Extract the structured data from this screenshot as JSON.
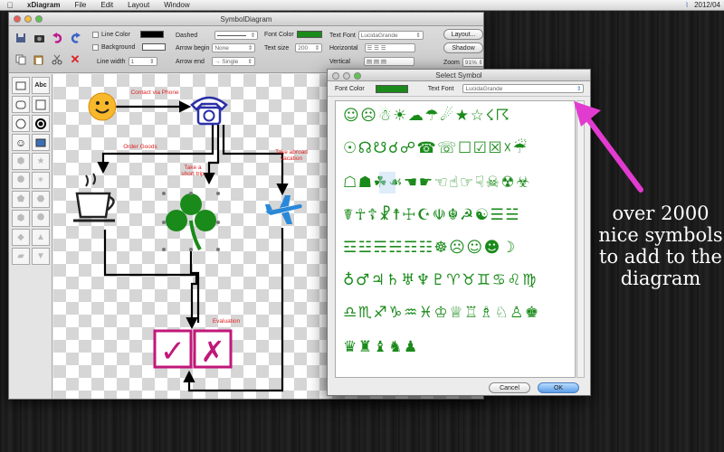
{
  "menubar": {
    "app_name": "xDiagram",
    "items": [
      "File",
      "Edit",
      "Layout",
      "Window"
    ],
    "clock": "2012/04"
  },
  "main_window": {
    "title": "SymbolDiagram",
    "toolbar": {
      "line_color_label": "Line Color",
      "background_label": "Background",
      "line_width_label": "Line width",
      "line_width_value": "1",
      "dashed_label": "Dashed",
      "arrow_begin_label": "Arrow begin",
      "arrow_begin_value": "None",
      "arrow_end_label": "Arrow end",
      "arrow_end_value": "Single",
      "font_color_label": "Font Color",
      "text_size_label": "Text size",
      "text_size_value": "200",
      "text_font_label": "Text Font",
      "text_font_value": "LucidaGrande",
      "horizontal_label": "Horizontal",
      "vertical_label": "Vertical",
      "layout_button": "Layout...",
      "shadow_button": "Shadow",
      "zoom_label": "Zoom",
      "zoom_value": "91%"
    },
    "palette": {
      "text_tool": "Abc"
    },
    "diagram_labels": {
      "contact": "Contact via Phone",
      "order": "Order Goods",
      "trip": "Take a short trip",
      "abroad": "Take abroad vacation",
      "evaluation": "Evaluation"
    }
  },
  "dialog": {
    "title": "Select Symbol",
    "font_color_label": "Font Color",
    "text_font_label": "Text Font",
    "text_font_value": "LucidaGrande",
    "symbol_rows": [
      "☺☹☃☀☁☂☄★☆☇☈",
      "☉☊☋☌☍☎☏☐☑☒☓☔",
      "☖☗☘☙☚☛☜☝☞☟☠☢☣",
      "☤☥☦☧☨☩☪☫☬☭☯☰☱",
      "☲☳☴☵☶☷☸☹☺☻☽",
      "♁♂♃♄♅♆♇♈♉♊♋♌♍",
      "♎♏♐♑♒♓♔♕♖♗♘♙♚",
      "♛♜♝♞♟"
    ],
    "cancel_button": "Cancel",
    "ok_button": "OK"
  },
  "promo_text": "over 2000 nice symbols to add to the diagram",
  "colors": {
    "accent_green": "#1a8a1a",
    "label_red": "#e02020",
    "diagram_blue": "#2a2fa8",
    "check_magenta": "#c0187a",
    "arrow_pink": "#e23bd0"
  }
}
